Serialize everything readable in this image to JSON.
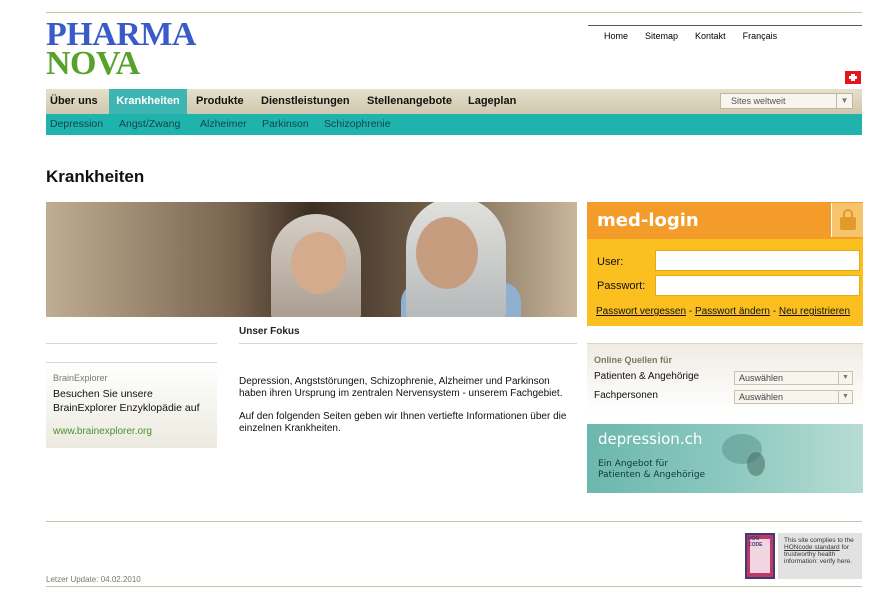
{
  "logo": {
    "line1": "PHARMA",
    "line2": "NOVA"
  },
  "util_nav": [
    "Home",
    "Sitemap",
    "Kontakt",
    "Français"
  ],
  "main_nav": [
    "Über uns",
    "Krankheiten",
    "Produkte",
    "Dienstleistungen",
    "Stellenangebote",
    "Lageplan"
  ],
  "active_main_nav": "Krankheiten",
  "sites_select": "Sites weltweit",
  "sub_nav": [
    "Depression",
    "Angst/Zwang",
    "Alzheimer",
    "Parkinson",
    "Schizophrenie"
  ],
  "page_title": "Krankheiten",
  "brainexplorer": {
    "heading": "BrainExplorer",
    "text": "Besuchen Sie unsere BrainExplorer Enzyklopädie auf",
    "link": "www.brainexplorer.org"
  },
  "fokus": {
    "title": "Unser Fokus",
    "p1": "Depression, Angststörungen, Schizophrenie, Alzheimer und Parkinson haben ihren Ursprung im zentralen Nervensystem - unserem Fachgebiet.",
    "p2": "Auf den folgenden Seiten geben wir Ihnen vertiefte Informationen über die einzelnen Krankheiten."
  },
  "medlogin": {
    "title": "med-login",
    "user_label": "User:",
    "user_value": "",
    "password_label": "Passwort:",
    "password_value": "",
    "link_forgot": "Passwort vergessen",
    "sep1": " - ",
    "link_change": "Passwort ändern",
    "sep2": " - ",
    "link_register": "Neu registrieren"
  },
  "quellen": {
    "heading": "Online Quellen für",
    "row1_label": "Patienten & Angehörige",
    "row1_select": "Auswählen",
    "row2_label": "Fachpersonen",
    "row2_select": "Auswählen"
  },
  "depression_banner": {
    "title": "depression.ch",
    "line1": "Ein Angebot für",
    "line2": "Patienten & Angehörige"
  },
  "hon": {
    "seal_label": "HON CODE",
    "text_pre": "This site complies to the ",
    "text_link": "HONcode standard",
    "text_post": " for trustworthy health information: verify here."
  },
  "last_update": "Letzer Update: 04.02.2010"
}
